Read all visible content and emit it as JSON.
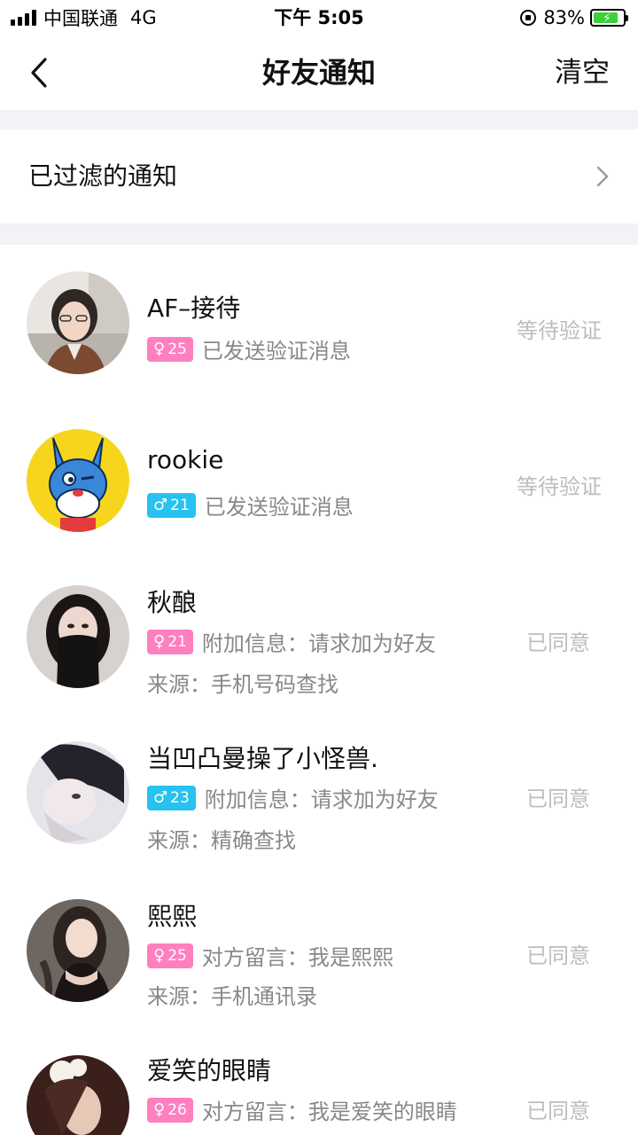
{
  "status_bar": {
    "carrier": "中国联通",
    "network": "4G",
    "time": "下午 5:05",
    "battery": "83%",
    "battery_level": 0.83,
    "battery_color": "#3ad13a"
  },
  "nav": {
    "title": "好友通知",
    "clear": "清空",
    "back_icon": "chevron-left-icon"
  },
  "filtered": {
    "label": "已过滤的通知",
    "icon": "chevron-right-icon"
  },
  "colors": {
    "female_badge": "#ff7fbf",
    "male_badge": "#26c2f0",
    "muted_text": "#888888",
    "status_text": "#bdbdbd",
    "separator": "#f2f3f6"
  },
  "notifications": [
    {
      "name": "AF–接待",
      "gender": "female",
      "gender_symbol": "♀",
      "age": "25",
      "message": "已发送验证消息",
      "source": "",
      "status": "等待验证"
    },
    {
      "name": "rookie",
      "gender": "male",
      "gender_symbol": "♂",
      "age": "21",
      "message": "已发送验证消息",
      "source": "",
      "status": "等待验证"
    },
    {
      "name": "秋酿",
      "gender": "female",
      "gender_symbol": "♀",
      "age": "21",
      "message": "附加信息：请求加为好友",
      "source": "来源：手机号码查找",
      "status": "已同意"
    },
    {
      "name": "当凹凸曼操了小怪兽.",
      "gender": "male",
      "gender_symbol": "♂",
      "age": "23",
      "message": "附加信息：请求加为好友",
      "source": "来源：精确查找",
      "status": "已同意"
    },
    {
      "name": "熙熙",
      "gender": "female",
      "gender_symbol": "♀",
      "age": "25",
      "message": "对方留言：我是熙熙",
      "source": "来源：手机通讯录",
      "status": "已同意"
    },
    {
      "name": "爱笑的眼睛",
      "gender": "female",
      "gender_symbol": "♀",
      "age": "26",
      "message": "对方留言：我是爱笑的眼睛",
      "source": "",
      "status": "已同意"
    }
  ]
}
